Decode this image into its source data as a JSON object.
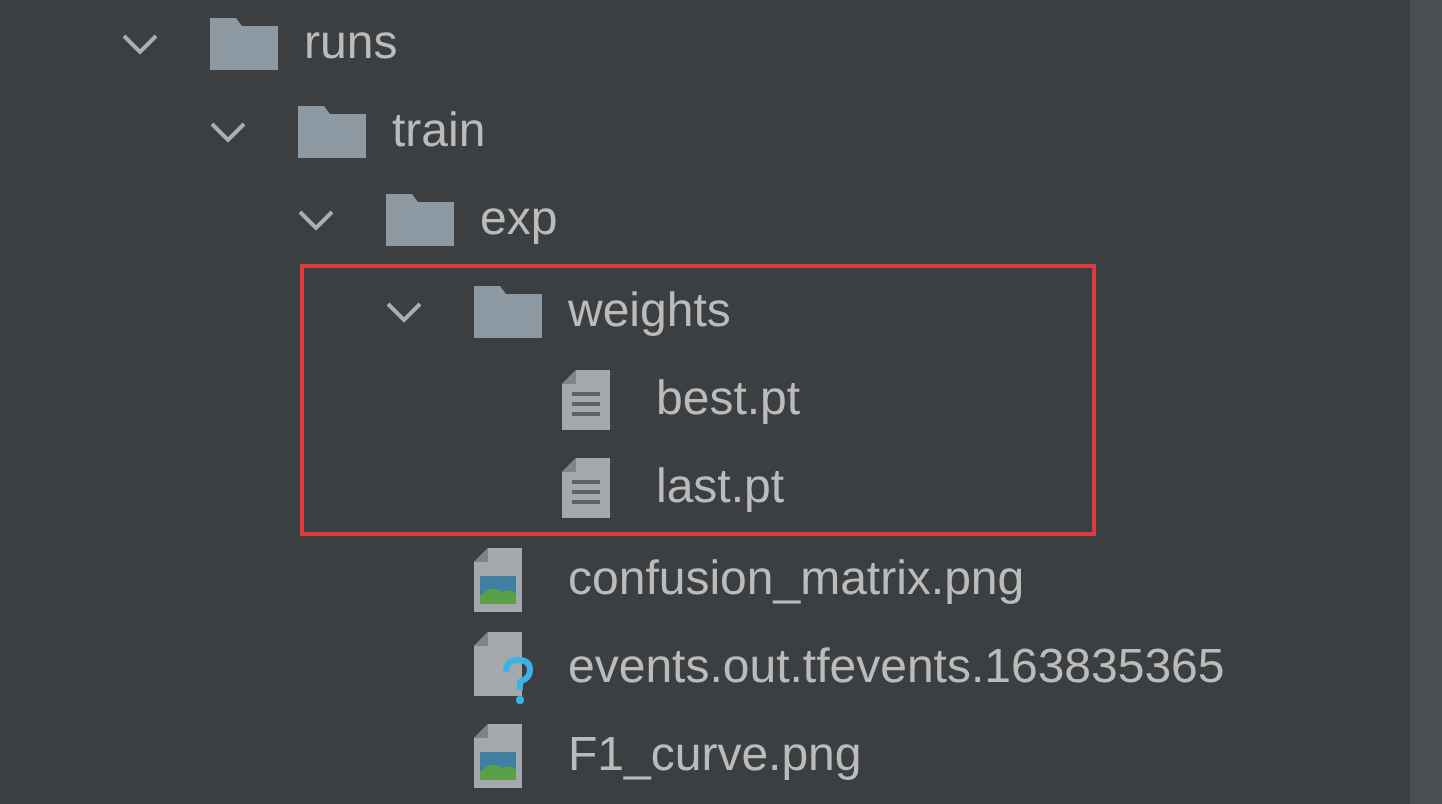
{
  "tree": [
    {
      "name": "runs",
      "kind": "folder",
      "expanded": true,
      "highlighted": false,
      "children": [
        {
          "name": "train",
          "kind": "folder",
          "expanded": true,
          "highlighted": false,
          "children": [
            {
              "name": "exp",
              "kind": "folder",
              "expanded": true,
              "highlighted": false,
              "children": [
                {
                  "name": "weights",
                  "kind": "folder",
                  "expanded": true,
                  "highlighted": true,
                  "children": [
                    {
                      "name": "best.pt",
                      "kind": "file"
                    },
                    {
                      "name": "last.pt",
                      "kind": "file"
                    }
                  ]
                },
                {
                  "name": "confusion_matrix.png",
                  "kind": "image"
                },
                {
                  "name": "events.out.tfevents.163835365",
                  "kind": "unknown"
                },
                {
                  "name": "F1_curve.png",
                  "kind": "image"
                }
              ]
            }
          ]
        }
      ]
    }
  ]
}
